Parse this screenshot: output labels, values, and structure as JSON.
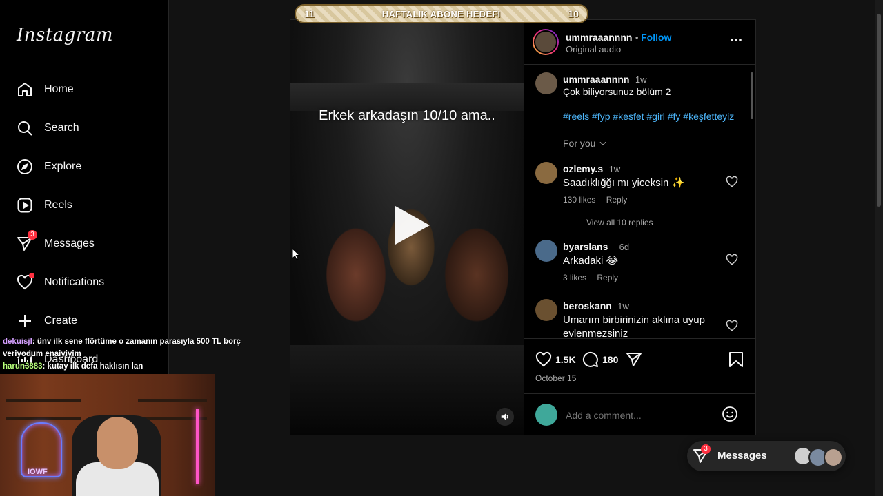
{
  "sidebar": {
    "logo": "Instagram",
    "items": [
      {
        "label": "Home"
      },
      {
        "label": "Search"
      },
      {
        "label": "Explore"
      },
      {
        "label": "Reels"
      },
      {
        "label": "Messages",
        "badge": "3"
      },
      {
        "label": "Notifications"
      },
      {
        "label": "Create"
      },
      {
        "label": "Dashboard"
      }
    ]
  },
  "banner": {
    "left": "11",
    "title": "HAFTALIK ABONE HEDEFI",
    "right": "10"
  },
  "video": {
    "caption": "Erkek arkadaşın 10/10 ama.."
  },
  "post": {
    "username": "ummraaannnn",
    "follow": "Follow",
    "audio": "Original audio",
    "caption_user": "ummraaannnn",
    "caption_time": "1w",
    "caption_text": "Çok biliyorsunuz bölüm 2",
    "hashtags": "#reels #fyp #kesfet #girl #fy #keşfetteyiz",
    "sort": "For you",
    "likes": "1.5K",
    "comments_count": "180",
    "date": "October 15",
    "add_comment_placeholder": "Add a comment..."
  },
  "comments": [
    {
      "user": "ozlemy.s",
      "time": "1w",
      "text": "Saadıklığğı mı yiceksin ✨",
      "likes": "130 likes",
      "reply": "Reply",
      "replies": "View all 10 replies"
    },
    {
      "user": "byarslans_",
      "time": "6d",
      "text": "Arkadaki 😂",
      "likes": "3 likes",
      "reply": "Reply"
    },
    {
      "user": "beroskann",
      "time": "1w",
      "text": "Umarım birbirinizin aklına uyup evlenmezsiniz"
    }
  ],
  "chat": [
    {
      "user": "dekuisjl",
      "text": ": ünv ilk sene flörtüme o zamanın parasıyla 500 TL borç veriyodum enaiyiyim"
    },
    {
      "user": "harun3883",
      "text": ": kutay ilk defa haklısın lan"
    }
  ],
  "webcam": {
    "neon": "IOWF"
  },
  "messages_pill": {
    "label": "Messages",
    "badge": "3"
  },
  "colors": {
    "accent": "#0095f6",
    "badge": "#ff3040",
    "background": "#121212"
  }
}
